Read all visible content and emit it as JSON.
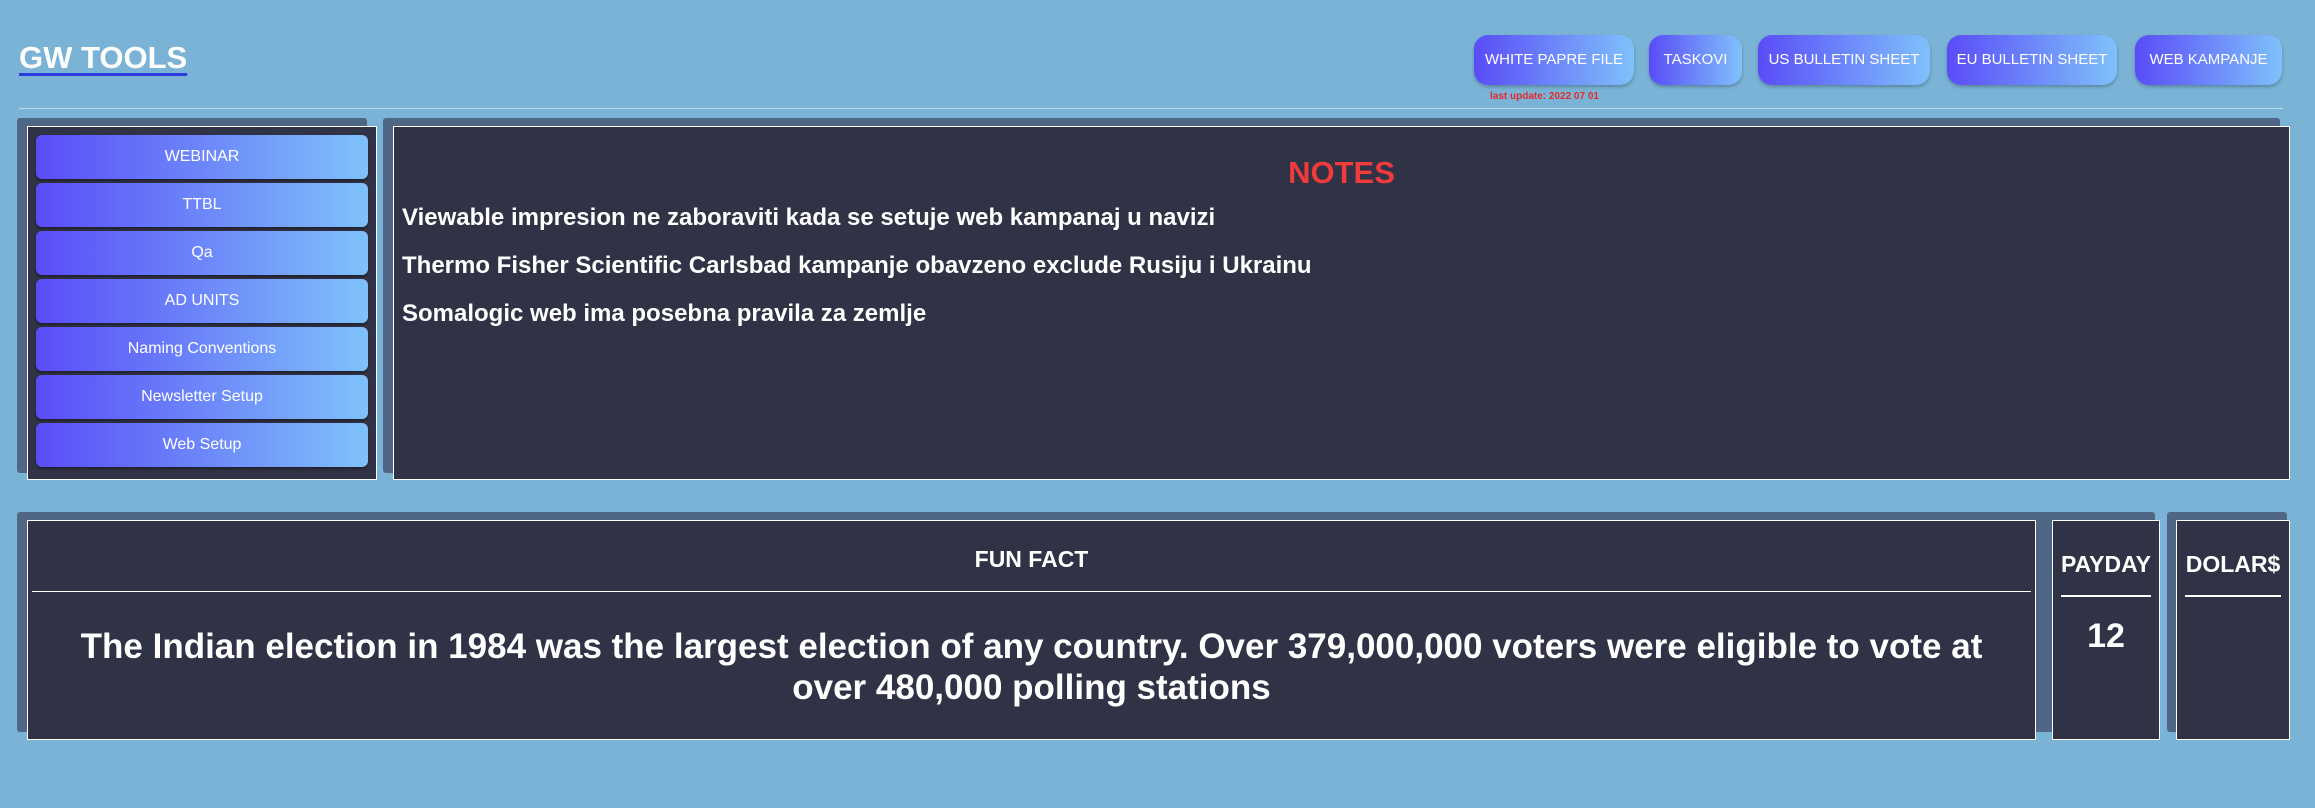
{
  "header": {
    "brand": "GW TOOLS",
    "nav": [
      {
        "label": "WHITE PAPRE FILE"
      },
      {
        "label": "TASKOVI"
      },
      {
        "label": "US BULLETIN SHEET"
      },
      {
        "label": "EU BULLETIN SHEET"
      },
      {
        "label": "WEB KAMPANJE"
      }
    ],
    "last_update": "last update: 2022 07 01"
  },
  "sidebar": {
    "items": [
      {
        "label": "WEBINAR"
      },
      {
        "label": "TTBL"
      },
      {
        "label": "Qa"
      },
      {
        "label": "AD UNITS"
      },
      {
        "label": "Naming Conventions"
      },
      {
        "label": "Newsletter Setup"
      },
      {
        "label": "Web Setup"
      }
    ]
  },
  "notes": {
    "title": "NOTES",
    "items": [
      "Viewable impresion ne zaboraviti kada se setuje web kampanaj u navizi",
      "Thermo Fisher Scientific Carlsbad kampanje obavzeno exclude Rusiju i Ukrainu",
      "Somalogic web ima posebna pravila za zemlje"
    ]
  },
  "fun_fact": {
    "title": "FUN FACT",
    "text": "The Indian election in 1984 was the largest election of any country. Over 379,000,000 voters were eligible to vote at over 480,000 polling stations"
  },
  "payday": {
    "title": "PAYDAY",
    "value": "12"
  },
  "dolar": {
    "title": "DOLAR$",
    "value": ""
  }
}
